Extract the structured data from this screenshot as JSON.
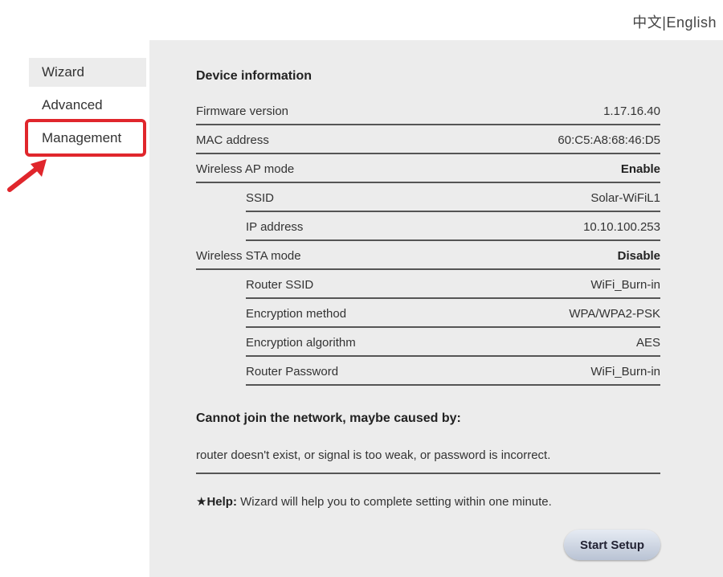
{
  "language": {
    "chinese": "中文",
    "separator": "|",
    "english": "English"
  },
  "sidebar": {
    "items": [
      {
        "label": "Wizard"
      },
      {
        "label": "Advanced"
      },
      {
        "label": "Management"
      }
    ]
  },
  "annotation": {
    "highlight_color": "#e0262c"
  },
  "device_info": {
    "title": "Device information",
    "rows": [
      {
        "label": "Firmware version",
        "value": "1.17.16.40"
      },
      {
        "label": "MAC address",
        "value": "60:C5:A8:68:46:D5"
      },
      {
        "label": "Wireless AP mode",
        "value": "Enable"
      },
      {
        "label": "SSID",
        "value": "Solar-WiFiL1"
      },
      {
        "label": "IP address",
        "value": "10.10.100.253"
      },
      {
        "label": "Wireless STA mode",
        "value": "Disable"
      },
      {
        "label": "Router SSID",
        "value": "WiFi_Burn-in"
      },
      {
        "label": "Encryption method",
        "value": "WPA/WPA2-PSK"
      },
      {
        "label": "Encryption algorithm",
        "value": "AES"
      },
      {
        "label": "Router Password",
        "value": "WiFi_Burn-in"
      }
    ]
  },
  "network_issue": {
    "title": "Cannot join the network, maybe caused by:",
    "reason": "router doesn't exist, or signal is too weak, or password is incorrect."
  },
  "help": {
    "label": "★Help:",
    "text": " Wizard will help you to complete setting within one minute."
  },
  "start_button": "Start Setup"
}
